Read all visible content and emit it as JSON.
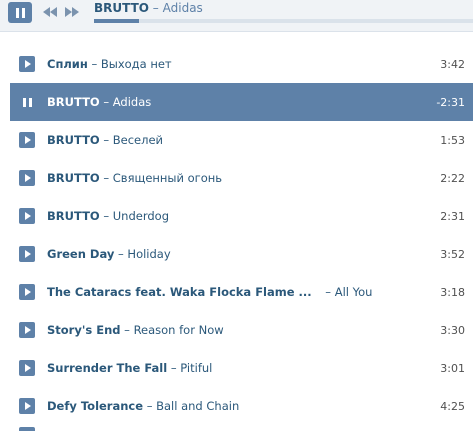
{
  "player": {
    "now_playing": {
      "artist": "BRUTTO",
      "separator": " – ",
      "track": "Adidas"
    },
    "progress_fraction": 0.12
  },
  "tracks": [
    {
      "artist": "Сплин",
      "separator": " – ",
      "track": "Выхода нет",
      "duration": "3:42"
    },
    {
      "artist": "BRUTTO",
      "separator": " – ",
      "track": "Adidas",
      "duration": "-2:31"
    },
    {
      "artist": "BRUTTO",
      "separator": " – ",
      "track": "Веселей",
      "duration": "1:53"
    },
    {
      "artist": "BRUTTO",
      "separator": " – ",
      "track": "Священный огонь",
      "duration": "2:22"
    },
    {
      "artist": "BRUTTO",
      "separator": " – ",
      "track": "Underdog",
      "duration": "2:31"
    },
    {
      "artist": "Green Day",
      "separator": " – ",
      "track": "Holiday",
      "duration": "3:52"
    },
    {
      "artist": "The Cataracs feat. Waka Flocka Flame ...",
      "separator": " – ",
      "track": "All You",
      "duration": "3:18"
    },
    {
      "artist": "Story's End",
      "separator": " – ",
      "track": "Reason for Now",
      "duration": "3:30"
    },
    {
      "artist": "Surrender The Fall",
      "separator": " – ",
      "track": "Pitiful",
      "duration": "3:01"
    },
    {
      "artist": "Defy Tolerance",
      "separator": " – ",
      "track": "Ball and Chain",
      "duration": "4:25"
    }
  ],
  "colors": {
    "accent": "#5e81a8",
    "text": "#2b587a",
    "duration": "#505050"
  }
}
